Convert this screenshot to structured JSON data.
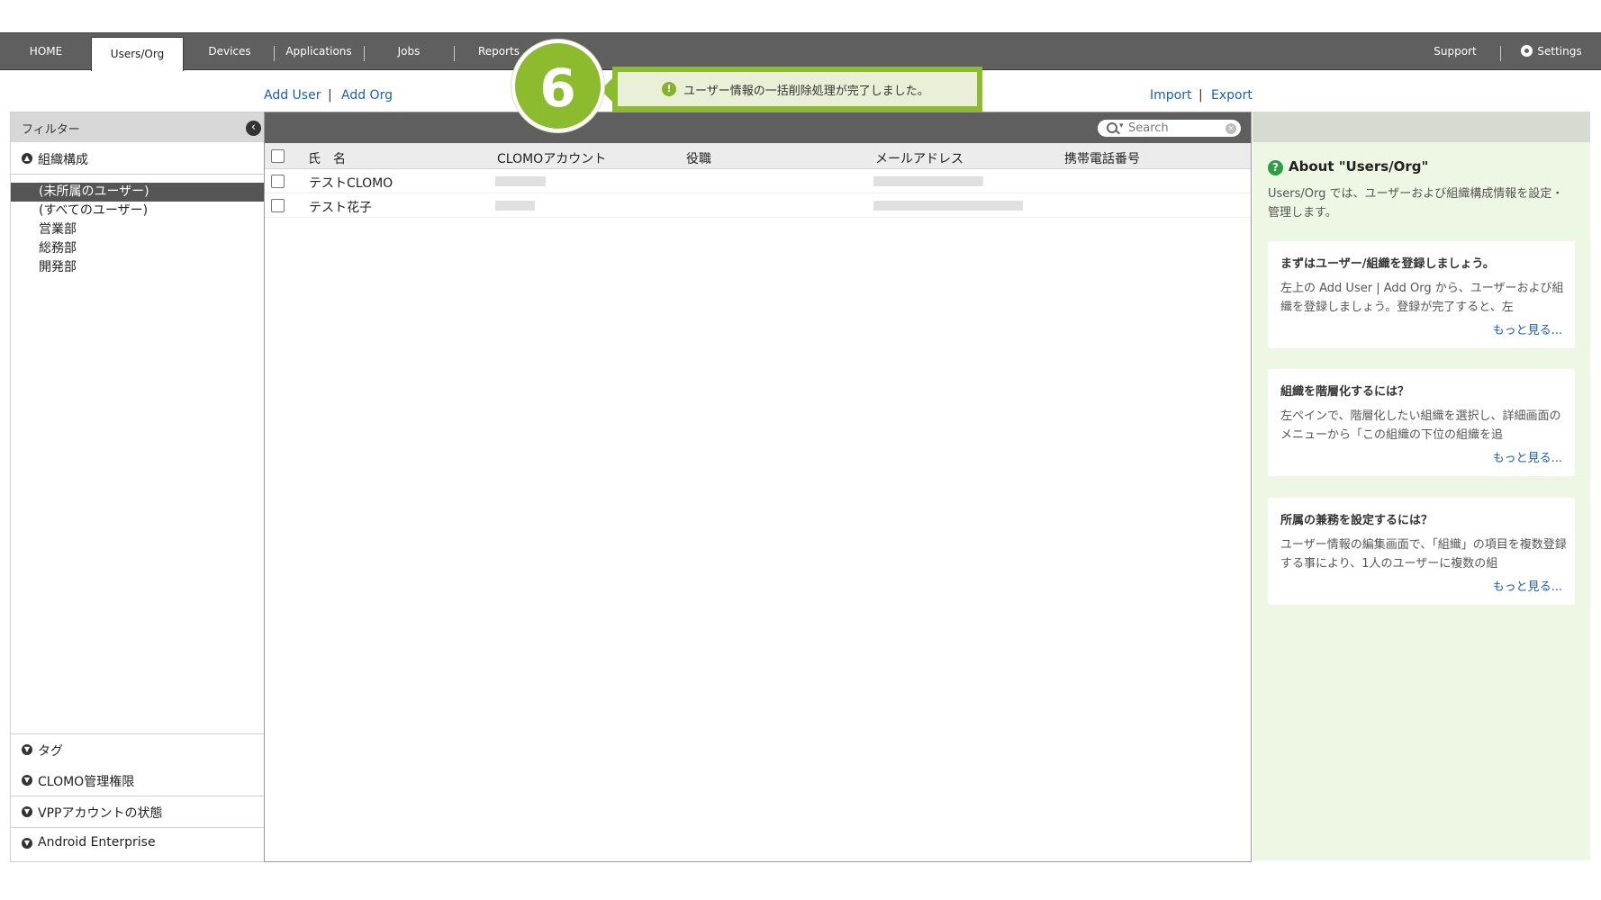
{
  "nav": {
    "tabs": [
      "HOME",
      "Users/Org",
      "Devices",
      "Applications",
      "Jobs",
      "Reports"
    ],
    "active_tab": "Users/Org",
    "right": [
      "Support",
      "Settings"
    ]
  },
  "actions": {
    "add_user": "Add User",
    "add_org": "Add Org",
    "import": "Import",
    "export": "Export",
    "separator": "|"
  },
  "sidebar": {
    "filter_title": "フィルター",
    "org_section": "組織構成",
    "org_items": [
      "(未所属のユーザー)",
      "(すべてのユーザー)",
      "営業部",
      "総務部",
      "開発部"
    ],
    "selected_org": "(未所属のユーザー)",
    "bottom_sections": [
      "タグ",
      "CLOMO管理権限",
      "VPPアカウントの状態",
      "Android Enterprise"
    ]
  },
  "table": {
    "search_placeholder": "Search",
    "columns": [
      "氏　名",
      "CLOMOアカウント",
      "役職",
      "メールアドレス",
      "携帯電話番号"
    ],
    "rows": [
      {
        "name": "テストCLOMO"
      },
      {
        "name": "テスト花子"
      }
    ]
  },
  "help": {
    "title": "About \"Users/Org\"",
    "description": "Users/Org では、ユーザーおよび組織構成情報を設定・管理します。",
    "cards": [
      {
        "title": "まずはユーザー/組織を登録しましょう。",
        "body": "左上の Add User | Add Org から、ユーザーおよび組織を登録しましょう。登録が完了すると、左",
        "more": "もっと見る..."
      },
      {
        "title": "組織を階層化するには？",
        "body": "左ペインで、階層化したい組織を選択し、詳細画面のメニューから「この組織の下位の組織を追",
        "more": "もっと見る..."
      },
      {
        "title": "所属の兼務を設定するには？",
        "body": "ユーザー情報の編集画面で、「組織」の項目を複数登録する事により、1人のユーザーに複数の組",
        "more": "もっと見る..."
      }
    ]
  },
  "toast": {
    "message": "ユーザー情報の一括削除処理が完了しました。",
    "step_number": "6"
  },
  "colors": {
    "accent_green": "#8cbb2e",
    "nav_bg": "#5f5f5f",
    "link_blue": "#1a5faf",
    "help_bg": "#eef7e3"
  }
}
